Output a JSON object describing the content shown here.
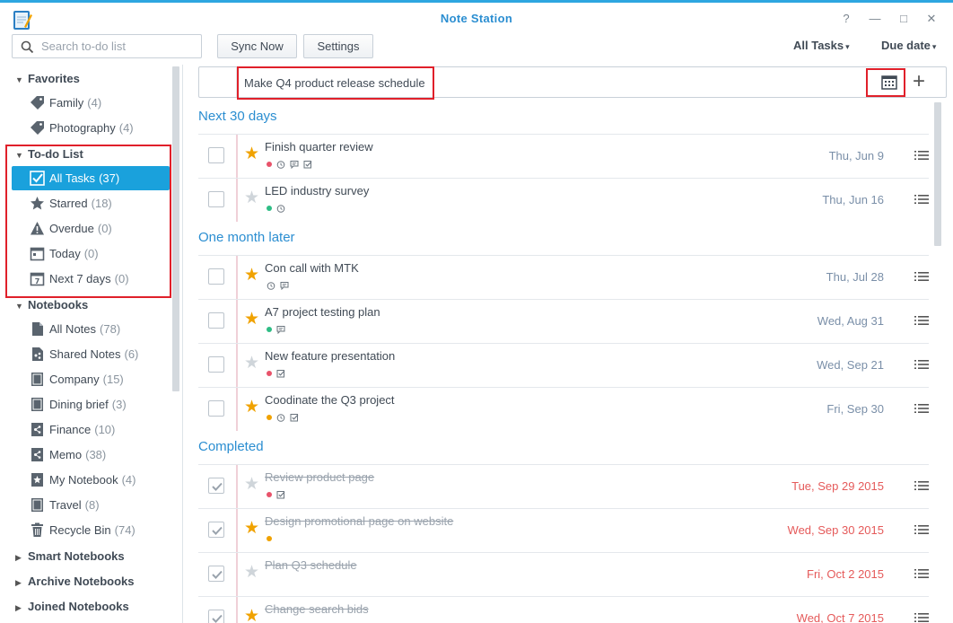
{
  "window": {
    "title": "Note Station",
    "help": "?",
    "minimize": "—",
    "maximize": "□",
    "close": "✕"
  },
  "toolbar": {
    "search_placeholder": "Search to-do list",
    "sync_label": "Sync Now",
    "settings_label": "Settings",
    "filter_label": "All Tasks",
    "sort_label": "Due date"
  },
  "sidebar": {
    "favorites": {
      "label": "Favorites",
      "items": [
        {
          "label": "Family",
          "count": "(4)",
          "icon": "tag-icon"
        },
        {
          "label": "Photography",
          "count": "(4)",
          "icon": "tag-icon"
        }
      ]
    },
    "todo": {
      "label": "To-do List",
      "items": [
        {
          "label": "All Tasks",
          "count": "(37)",
          "icon": "checkbox-icon"
        },
        {
          "label": "Starred",
          "count": "(18)",
          "icon": "star-icon"
        },
        {
          "label": "Overdue",
          "count": "(0)",
          "icon": "warning-icon"
        },
        {
          "label": "Today",
          "count": "(0)",
          "icon": "calendar-icon"
        },
        {
          "label": "Next 7 days",
          "count": "(0)",
          "icon": "calendar-week-icon"
        }
      ]
    },
    "notebooks": {
      "label": "Notebooks",
      "items": [
        {
          "label": "All Notes",
          "count": "(78)",
          "icon": "notes-icon"
        },
        {
          "label": "Shared Notes",
          "count": "(6)",
          "icon": "shared-notes-icon"
        },
        {
          "label": "Company",
          "count": "(15)",
          "icon": "notebook-icon"
        },
        {
          "label": "Dining brief",
          "count": "(3)",
          "icon": "notebook-icon"
        },
        {
          "label": "Finance",
          "count": "(10)",
          "icon": "shared-notebook-icon"
        },
        {
          "label": "Memo",
          "count": "(38)",
          "icon": "shared-notebook-icon"
        },
        {
          "label": "My Notebook",
          "count": "(4)",
          "icon": "starred-notebook-icon"
        },
        {
          "label": "Travel",
          "count": "(8)",
          "icon": "notebook-icon"
        },
        {
          "label": "Recycle Bin",
          "count": "(74)",
          "icon": "trash-icon"
        }
      ]
    },
    "smart": {
      "label": "Smart Notebooks"
    },
    "archive": {
      "label": "Archive Notebooks"
    },
    "joined": {
      "label": "Joined Notebooks"
    }
  },
  "new_task": {
    "value": "Make Q4 product release schedule"
  },
  "groups": [
    {
      "title": "Next 30 days",
      "tasks": [
        {
          "title": "Finish quarter review",
          "date": "Thu, Jun 9",
          "starred": true,
          "dot": "#e8536a",
          "icons": [
            "alarm-icon",
            "comment-icon",
            "checklist-icon"
          ]
        },
        {
          "title": "LED industry survey",
          "date": "Thu, Jun 16",
          "starred": false,
          "dot": "#2ebd85",
          "icons": [
            "alarm-icon"
          ]
        }
      ]
    },
    {
      "title": "One month later",
      "tasks": [
        {
          "title": "Con call with MTK",
          "date": "Thu, Jul 28",
          "starred": true,
          "dot": "",
          "icons": [
            "alarm-icon",
            "comment-icon"
          ]
        },
        {
          "title": "A7 project testing plan",
          "date": "Wed, Aug 31",
          "starred": true,
          "dot": "#2ebd85",
          "icons": [
            "comment-icon"
          ]
        },
        {
          "title": "New feature presentation",
          "date": "Wed, Sep 21",
          "starred": false,
          "dot": "#e8536a",
          "icons": [
            "checklist-icon"
          ]
        },
        {
          "title": "Coodinate the Q3 project",
          "date": "Fri, Sep 30",
          "starred": true,
          "dot": "#f0a200",
          "icons": [
            "alarm-icon",
            "checklist-icon"
          ]
        }
      ]
    },
    {
      "title": "Completed",
      "tasks": [
        {
          "title": "Review product page",
          "date": "Tue, Sep 29 2015",
          "starred": false,
          "dot": "#e8536a",
          "icons": [
            "checklist-icon"
          ]
        },
        {
          "title": "Design promotional page on website",
          "date": "Wed, Sep 30 2015",
          "starred": true,
          "dot": "#f0a200",
          "icons": []
        },
        {
          "title": "Plan Q3 schedule",
          "date": "Fri, Oct 2 2015",
          "starred": false,
          "dot": "",
          "icons": []
        },
        {
          "title": "Change search bids",
          "date": "Wed, Oct 7 2015",
          "starred": true,
          "dot": "",
          "icons": []
        }
      ]
    }
  ]
}
